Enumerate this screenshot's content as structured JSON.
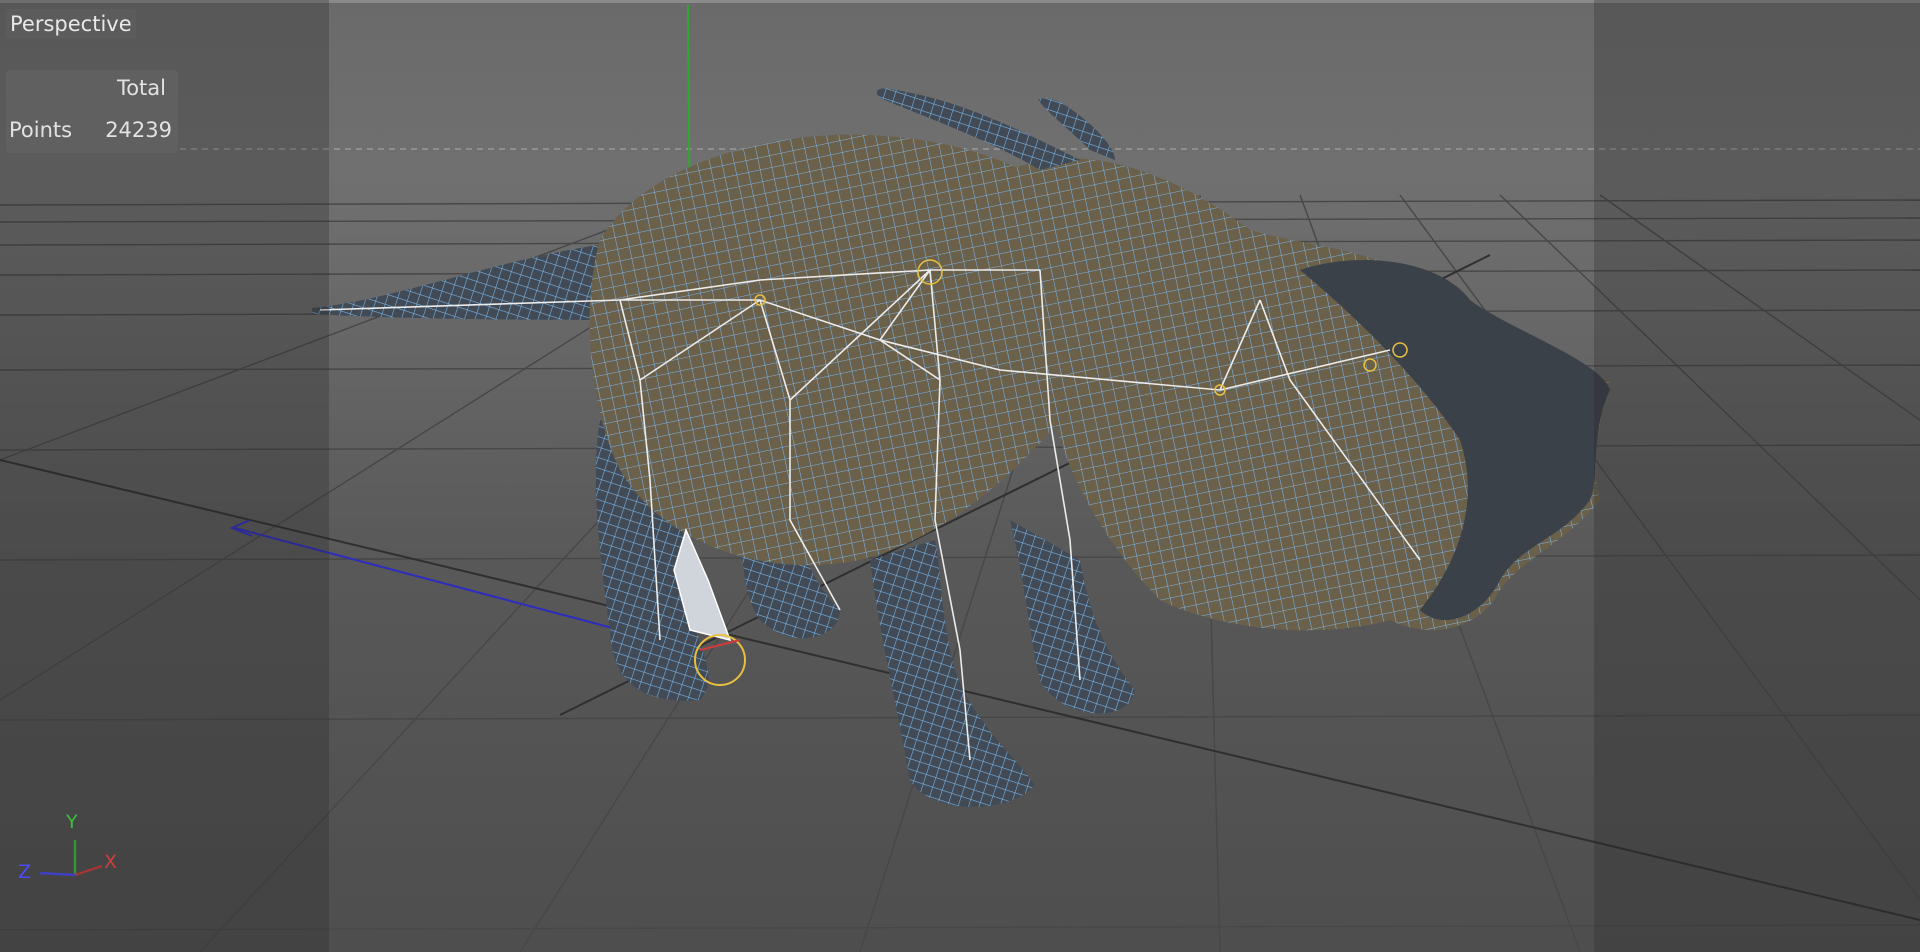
{
  "viewport": {
    "camera_label": "Perspective"
  },
  "stats": {
    "column_header": "Total",
    "row_label": "Points",
    "row_value": "24239"
  },
  "axis_gizmo": {
    "y_label": "Y",
    "x_label": "X",
    "z_label": "Z"
  },
  "colors": {
    "viewport_background": "#6a6a6a",
    "grid_line": "#4a4a4a",
    "mesh_wire": "#6fa8d8",
    "mesh_body": "#3a4048",
    "bone": "#e8e8e8",
    "axis_x": "#d23b3b",
    "axis_y": "#3bbf3b",
    "axis_z": "#4a4aff",
    "selection_handle": "#e8c040"
  },
  "scene": {
    "object": "rigged triceratops mesh with joints"
  }
}
